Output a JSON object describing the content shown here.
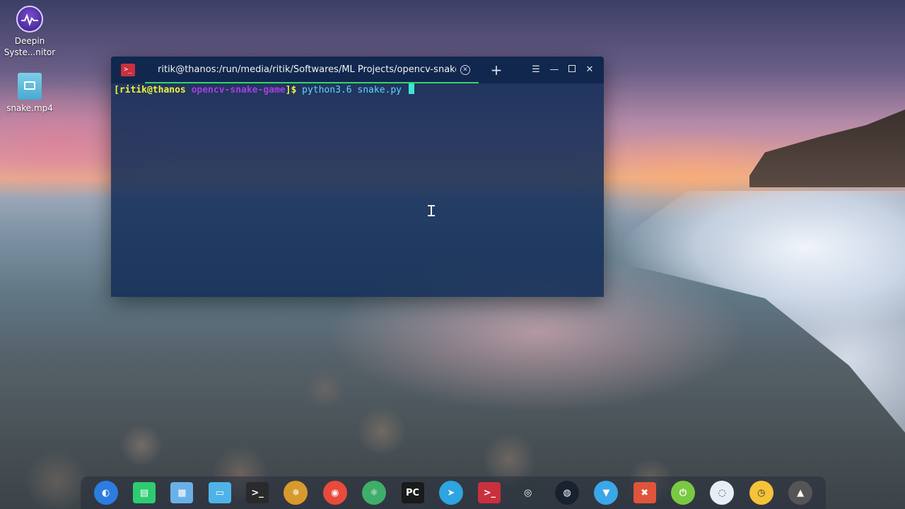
{
  "desktop": {
    "icons": [
      {
        "label": "Deepin\nSyste...nitor",
        "icon": "system-monitor-icon"
      },
      {
        "label": "snake.mp4",
        "icon": "video-file-icon"
      }
    ]
  },
  "terminal": {
    "tab_title": "ritik@thanos:/run/media/ritik/Softwares/ML Projects/opencv-snake-game",
    "prompt_open": "[",
    "prompt_user": "ritik@thanos",
    "prompt_dir": "opencv-snake-game",
    "prompt_close": "]$",
    "command": "python3.6 snake.py",
    "accent": "#3bd16f"
  },
  "dock": {
    "items": [
      {
        "name": "launcher-icon",
        "color": "#2b7de0"
      },
      {
        "name": "multitasking-icon",
        "color": "#2ecc71"
      },
      {
        "name": "image-viewer-icon",
        "color": "#6ab0e8"
      },
      {
        "name": "file-manager-icon",
        "color": "#4fb3e8"
      },
      {
        "name": "terminal-app-icon",
        "color": "#2a2a2a"
      },
      {
        "name": "helm-icon",
        "color": "#d89a2c"
      },
      {
        "name": "chrome-icon",
        "color": "#e84a3c"
      },
      {
        "name": "atom-icon",
        "color": "#3fae6a"
      },
      {
        "name": "pycharm-icon",
        "color": "#1a1a1a"
      },
      {
        "name": "telegram-icon",
        "color": "#2ca5e0"
      },
      {
        "name": "deepin-terminal-icon",
        "color": "#c9303e"
      },
      {
        "name": "camera-icon",
        "color": "#2e3a40"
      },
      {
        "name": "screen-recorder-icon",
        "color": "#18222e"
      },
      {
        "name": "wifi-icon",
        "color": "#3aa7e8"
      },
      {
        "name": "screenshot-icon",
        "color": "#e0543c"
      },
      {
        "name": "power-icon",
        "color": "#7ac943"
      },
      {
        "name": "system-monitor-icon",
        "color": "#e8eef5"
      },
      {
        "name": "clock-icon",
        "color": "#f6c23a"
      },
      {
        "name": "tux-icon",
        "color": "#555555"
      }
    ]
  }
}
